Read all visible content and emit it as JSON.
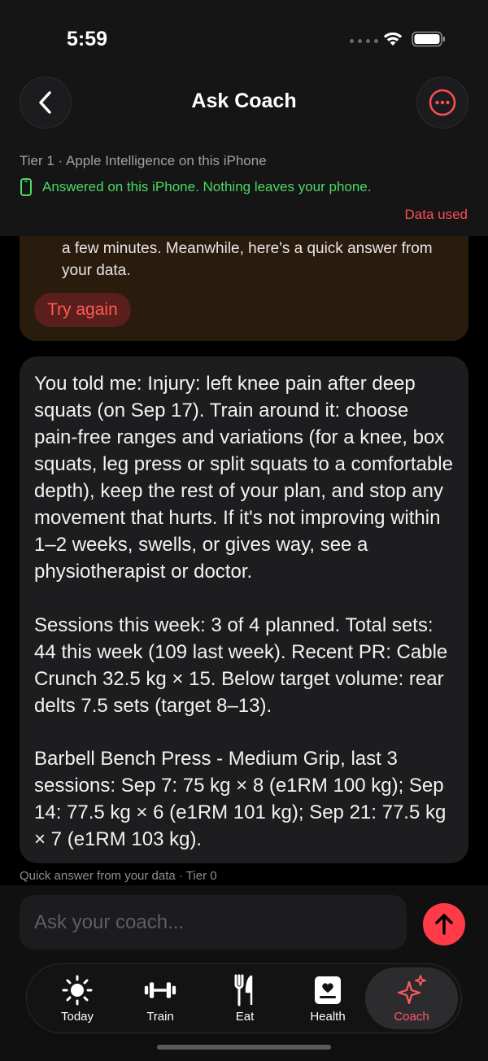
{
  "status_bar": {
    "time": "5:59"
  },
  "header": {
    "title": "Ask Coach",
    "tier_text": "Tier 1 · Apple Intelligence on this iPhone",
    "privacy_text": "Answered on this iPhone. Nothing leaves your phone.",
    "data_used_label": "Data used"
  },
  "error_card": {
    "text": "a few minutes. Meanwhile, here's a quick answer from your data.",
    "try_again_label": "Try again"
  },
  "answer": {
    "p1": "You told me: Injury: left knee pain after deep squats (on Sep 17). Train around it: choose pain-free ranges and variations (for a knee, box squats, leg press or split squats to a comfortable depth), keep the rest of your plan, and stop any movement that hurts. If it's not improving within 1–2 weeks, swells, or gives way, see a physiotherapist or doctor.",
    "p2": "Sessions this week: 3 of 4 planned. Total sets: 44 this week (109 last week). Recent PR: Cable Crunch 32.5 kg × 15. Below target volume: rear delts 7.5 sets (target 8–13).",
    "p3": "Barbell Bench Press - Medium Grip, last 3 sessions: Sep 7: 75 kg × 8 (e1RM 100 kg); Sep 14: 77.5 kg × 6 (e1RM 101 kg); Sep 21: 77.5 kg × 7 (e1RM 103 kg).",
    "footnote": "Quick answer from your data · Tier 0"
  },
  "composer": {
    "placeholder": "Ask your coach..."
  },
  "tabs": [
    {
      "label": "Today",
      "icon": "sun-icon"
    },
    {
      "label": "Train",
      "icon": "dumbbell-icon"
    },
    {
      "label": "Eat",
      "icon": "fork-knife-icon"
    },
    {
      "label": "Health",
      "icon": "heart-clipboard-icon"
    },
    {
      "label": "Coach",
      "icon": "sparkles-icon",
      "active": true
    }
  ],
  "colors": {
    "accent": "#ff3b4a",
    "privacy_green": "#4cd964",
    "background": "#000000"
  }
}
